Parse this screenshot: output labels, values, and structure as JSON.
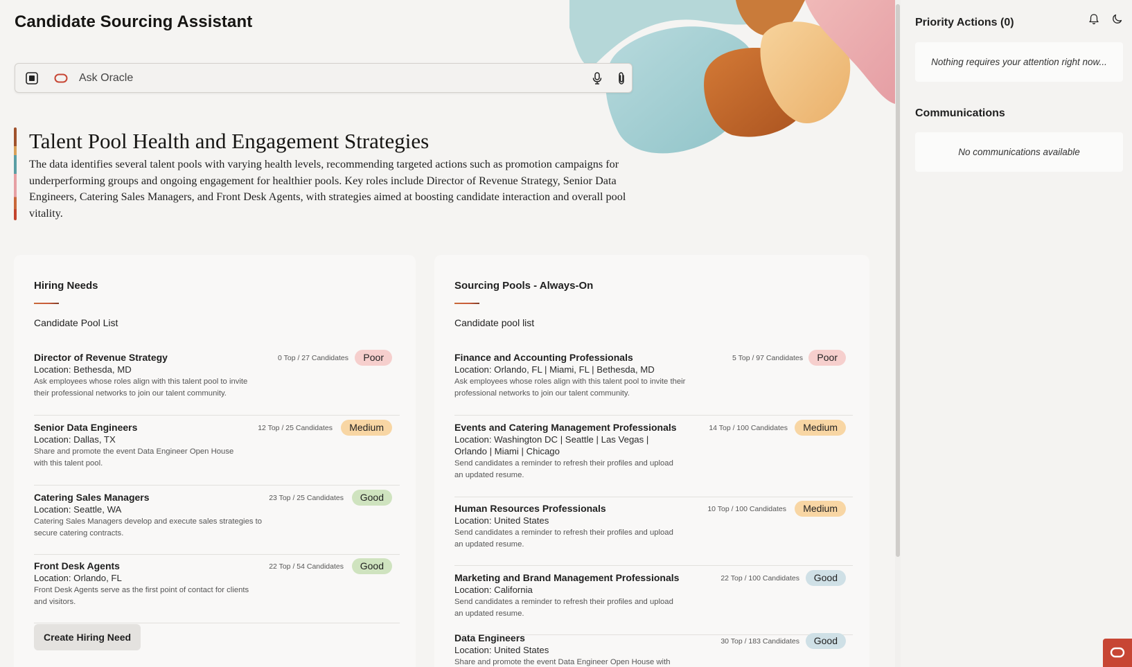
{
  "app": {
    "title": "Candidate Sourcing Assistant"
  },
  "ask": {
    "placeholder": "Ask Oracle"
  },
  "insight": {
    "title": "Talent Pool Health and Engagement Strategies",
    "body": "The data identifies several talent pools with varying health levels, recommending targeted actions such as promotion campaigns for underperforming groups and ongoing engagement for healthier pools. Key roles include Director of Revenue Strategy, Senior Data Engineers, Catering Sales Managers, and Front Desk Agents, with strategies aimed at boosting candidate interaction and overall pool vitality."
  },
  "hiring": {
    "title": "Hiring Needs",
    "subtitle": "Candidate Pool List",
    "create_label": "Create Hiring Need",
    "items": [
      {
        "name": "Director of Revenue Strategy",
        "location": "Location: Bethesda, MD",
        "desc": "Ask employees whose roles align with this talent pool to invite their professional networks to join our talent community.",
        "count": "0 Top / 27 Candidates",
        "status": "Poor"
      },
      {
        "name": "Senior Data Engineers",
        "location": "Location: Dallas, TX",
        "desc": "Share and promote the event Data Engineer Open House with this talent pool.",
        "count": "12 Top / 25 Candidates",
        "status": "Medium"
      },
      {
        "name": "Catering Sales Managers",
        "location": "Location: Seattle, WA",
        "desc": "Catering Sales Managers develop and execute sales strategies to secure catering contracts.",
        "count": "23 Top / 25 Candidates",
        "status": "Good"
      },
      {
        "name": "Front Desk Agents",
        "location": "Location: Orlando, FL",
        "desc": "Front Desk Agents serve as the first point of contact for clients and visitors.",
        "count": "22 Top / 54 Candidates",
        "status": "Good"
      }
    ]
  },
  "pools": {
    "title": "Sourcing Pools - Always-On",
    "subtitle": "Candidate pool list",
    "items": [
      {
        "name": "Finance and Accounting Professionals",
        "location": "Location: Orlando, FL | Miami, FL | Bethesda, MD",
        "desc": "Ask employees whose roles align with this talent pool to invite their professional networks to join our talent community.",
        "count": "5 Top / 97 Candidates",
        "status": "Poor"
      },
      {
        "name": "Events and Catering Management Professionals",
        "location": "Location: Washington DC | Seattle | Las Vegas | Orlando | Miami | Chicago",
        "desc": "Send candidates a reminder to refresh their profiles and upload an updated resume.",
        "count": "14 Top / 100 Candidates",
        "status": "Medium"
      },
      {
        "name": "Human Resources Professionals",
        "location": "Location: United States",
        "desc": "Send candidates a reminder to refresh their profiles and upload an updated resume.",
        "count": "10 Top / 100 Candidates",
        "status": "Medium"
      },
      {
        "name": "Marketing and Brand Management Professionals",
        "location": "Location: California",
        "desc": "Send candidates a reminder to refresh their profiles and upload an updated resume.",
        "count": "22 Top / 100 Candidates",
        "status": "Good"
      },
      {
        "name": "Data Engineers",
        "location": "Location: United States",
        "desc": "Share and promote the event Data Engineer Open House with this talent pool.",
        "count": "30 Top / 183 Candidates",
        "status": "Good"
      }
    ]
  },
  "side": {
    "priority_title": "Priority Actions (0)",
    "priority_empty": "Nothing requires your attention right now...",
    "comms_title": "Communications",
    "comms_empty": "No communications available"
  },
  "icons": {
    "stop": "stop-icon",
    "brand": "oracle-logo-icon",
    "mic": "microphone-icon",
    "attach": "paperclip-icon",
    "bell": "bell-icon",
    "theme": "moon-icon"
  },
  "colors": {
    "poor": "#f6cfcd",
    "medium": "#f8d6a4",
    "good": "#cfe3bf",
    "good_alt": "#cfe0e6",
    "brand": "#c74634"
  }
}
